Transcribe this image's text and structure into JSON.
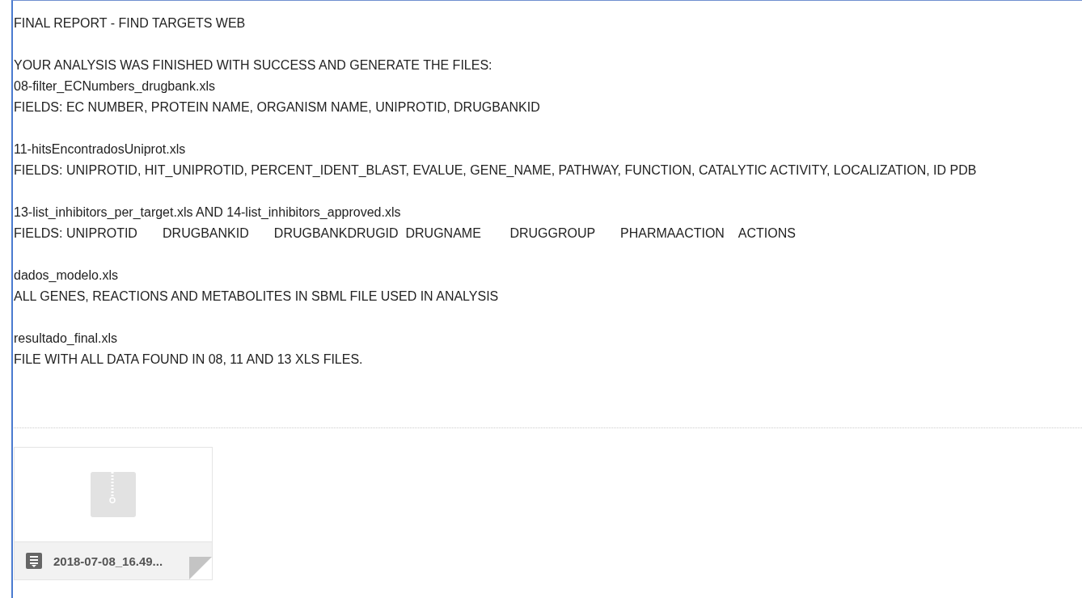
{
  "title": "FINAL REPORT - FIND TARGETS WEB",
  "paragraphs": [
    [
      "YOUR ANALYSIS WAS FINISHED WITH SUCCESS AND GENERATE THE FILES:",
      "08-filter_ECNumbers_drugbank.xls",
      "FIELDS: EC NUMBER, PROTEIN NAME, ORGANISM NAME, UNIPROTID, DRUGBANKID"
    ],
    [
      "11-hitsEncontradosUniprot.xls",
      "FIELDS: UNIPROTID, HIT_UNIPROTID, PERCENT_IDENT_BLAST, EVALUE, GENE_NAME, PATHWAY, FUNCTION, CATALYTIC ACTIVITY, LOCALIZATION, ID PDB"
    ],
    [
      "13-list_inhibitors_per_target.xls AND 14-list_inhibitors_approved.xls",
      "FIELDS: UNIPROTID       DRUGBANKID       DRUGBANKDRUGID  DRUGNAME        DRUGGROUP       PHARMAACTION    ACTIONS"
    ],
    [
      "dados_modelo.xls",
      "ALL GENES, REACTIONS AND METABOLITES IN SBML FILE USED IN ANALYSIS"
    ],
    [
      "resultado_final.xls",
      "FILE WITH ALL DATA FOUND IN 08, 11 AND 13 XLS FILES."
    ]
  ],
  "attachments": [
    {
      "name": "2018-07-08_16.49..."
    }
  ]
}
